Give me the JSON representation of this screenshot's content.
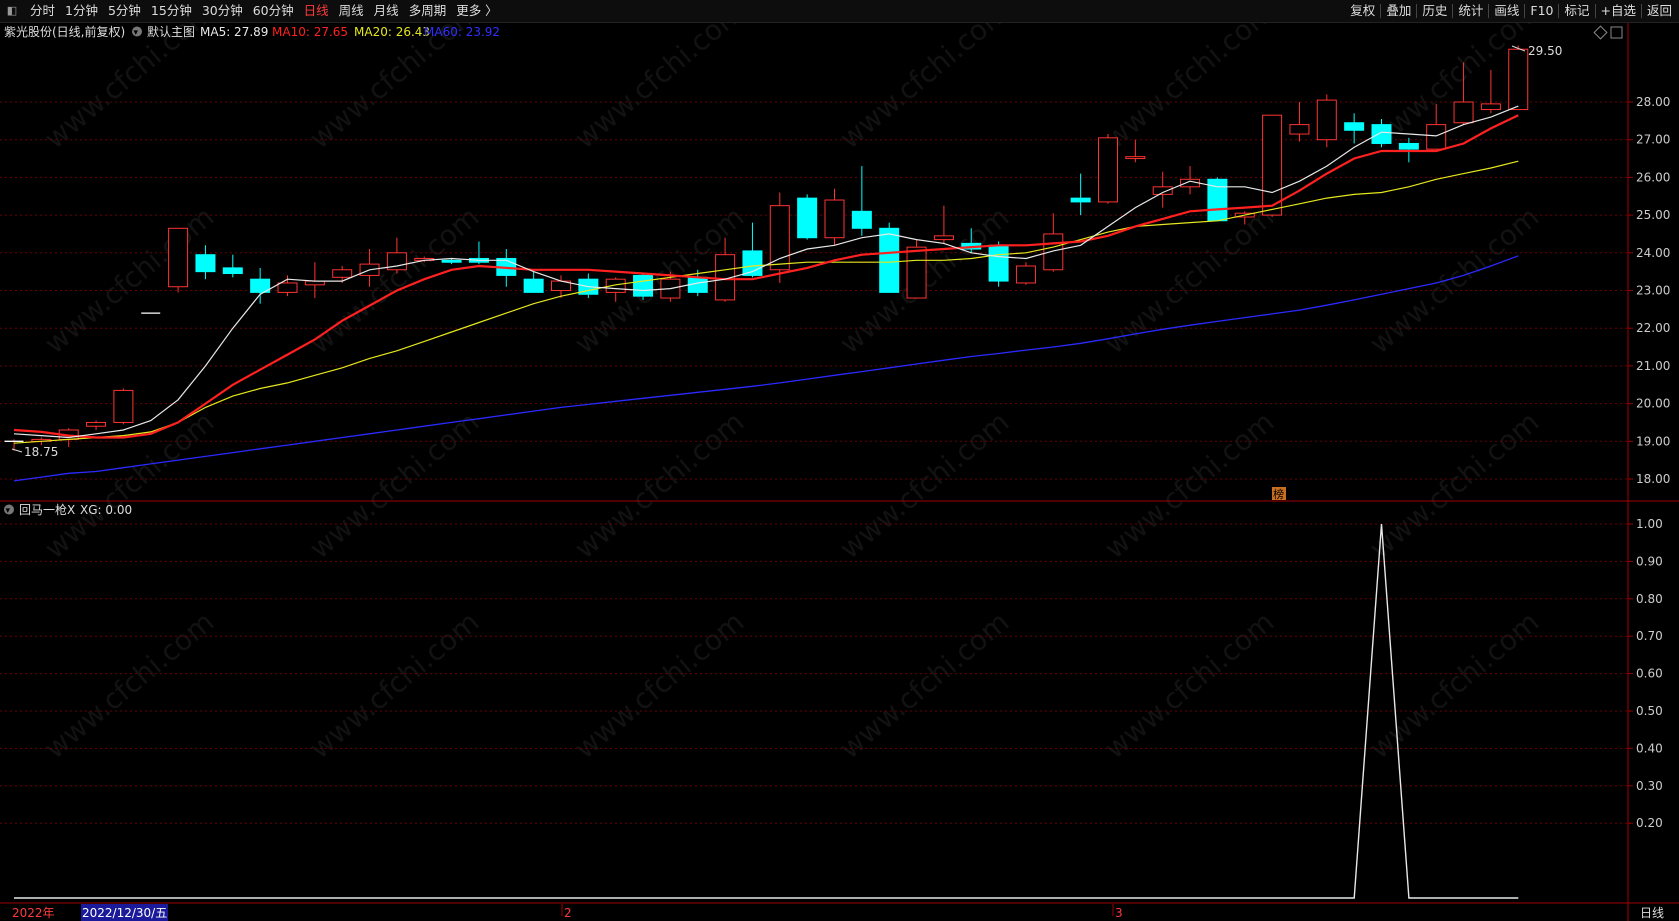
{
  "toolbar": {
    "tabs": [
      "分时",
      "1分钟",
      "5分钟",
      "15分钟",
      "30分钟",
      "60分钟",
      "日线",
      "周线",
      "月线",
      "多周期",
      "更多 〉"
    ],
    "active_tab": "日线",
    "tools": [
      "复权",
      "叠加",
      "历史",
      "统计",
      "画线",
      "F10",
      "标记",
      "+自选",
      "返回"
    ]
  },
  "main_legend": {
    "stock": "紫光股份(日线,前复权)",
    "template": "默认主图",
    "ma5": "MA5: 27.89",
    "ma10": "MA10: 27.65",
    "ma20": "MA20: 26.43",
    "ma60": "MA60: 23.92"
  },
  "colors": {
    "up": "#ff3232",
    "down": "#00ffff",
    "ma5": "#e8e8e8",
    "ma10": "#ff2020",
    "ma20": "#e6e61e",
    "ma60": "#2a2aff",
    "axis": "#a00000",
    "grid": "#6a0000"
  },
  "sub_legend": {
    "name": "回马一枪X",
    "value": "XG: 0.00"
  },
  "bottom_bar": {
    "year_label": "2022年",
    "cursor_date": "2022/12/30/五",
    "month_feb": "2",
    "month_mar": "3",
    "period": "日线"
  },
  "annotations": {
    "max_price": "29.50",
    "min_price": "18.75",
    "marker": "榜"
  },
  "watermark": "www.cfchi.com",
  "chart_data": [
    {
      "type": "candlestick",
      "title": "紫光股份(日线,前复权)",
      "ylim": [
        17.6,
        30.0
      ],
      "yticks": [
        "18.00",
        "19.00",
        "20.00",
        "21.00",
        "22.00",
        "23.00",
        "24.00",
        "25.00",
        "26.00",
        "27.00",
        "28.00"
      ],
      "candles": [
        {
          "o": 19.0,
          "h": 19.05,
          "l": 18.75,
          "c": 19.0
        },
        {
          "o": 19.0,
          "h": 19.1,
          "l": 18.9,
          "c": 19.05
        },
        {
          "o": 19.05,
          "h": 19.35,
          "l": 18.85,
          "c": 19.3
        },
        {
          "o": 19.4,
          "h": 19.55,
          "l": 19.3,
          "c": 19.5
        },
        {
          "o": 19.5,
          "h": 20.4,
          "l": 19.45,
          "c": 20.35
        },
        {
          "o": 22.4,
          "h": 22.4,
          "l": 22.4,
          "c": 22.4
        },
        {
          "o": 23.1,
          "h": 24.65,
          "l": 22.95,
          "c": 24.65
        },
        {
          "o": 23.95,
          "h": 24.2,
          "l": 23.3,
          "c": 23.5
        },
        {
          "o": 23.6,
          "h": 23.95,
          "l": 23.35,
          "c": 23.45
        },
        {
          "o": 23.3,
          "h": 23.6,
          "l": 22.65,
          "c": 22.95
        },
        {
          "o": 22.95,
          "h": 23.4,
          "l": 22.85,
          "c": 23.2
        },
        {
          "o": 23.15,
          "h": 23.75,
          "l": 22.8,
          "c": 23.25
        },
        {
          "o": 23.35,
          "h": 23.65,
          "l": 23.2,
          "c": 23.55
        },
        {
          "o": 23.4,
          "h": 24.1,
          "l": 23.1,
          "c": 23.7
        },
        {
          "o": 23.55,
          "h": 24.4,
          "l": 23.45,
          "c": 24.0
        },
        {
          "o": 23.8,
          "h": 23.9,
          "l": 23.75,
          "c": 23.85
        },
        {
          "o": 23.8,
          "h": 23.85,
          "l": 23.7,
          "c": 23.75
        },
        {
          "o": 23.85,
          "h": 24.3,
          "l": 23.7,
          "c": 23.75
        },
        {
          "o": 23.85,
          "h": 24.1,
          "l": 23.1,
          "c": 23.4
        },
        {
          "o": 23.3,
          "h": 23.5,
          "l": 22.95,
          "c": 22.95
        },
        {
          "o": 23.0,
          "h": 23.4,
          "l": 22.8,
          "c": 23.25
        },
        {
          "o": 23.3,
          "h": 23.45,
          "l": 22.8,
          "c": 22.9
        },
        {
          "o": 22.95,
          "h": 23.35,
          "l": 22.7,
          "c": 23.3
        },
        {
          "o": 23.4,
          "h": 23.45,
          "l": 22.75,
          "c": 22.85
        },
        {
          "o": 22.8,
          "h": 23.5,
          "l": 22.7,
          "c": 23.3
        },
        {
          "o": 23.35,
          "h": 23.55,
          "l": 22.85,
          "c": 22.95
        },
        {
          "o": 22.75,
          "h": 24.4,
          "l": 22.7,
          "c": 23.95
        },
        {
          "o": 24.05,
          "h": 24.8,
          "l": 23.35,
          "c": 23.4
        },
        {
          "o": 23.55,
          "h": 25.6,
          "l": 23.2,
          "c": 25.25
        },
        {
          "o": 25.45,
          "h": 25.55,
          "l": 24.35,
          "c": 24.4
        },
        {
          "o": 24.4,
          "h": 25.7,
          "l": 24.2,
          "c": 25.4
        },
        {
          "o": 25.1,
          "h": 26.3,
          "l": 24.45,
          "c": 24.65
        },
        {
          "o": 24.65,
          "h": 24.8,
          "l": 22.95,
          "c": 22.95
        },
        {
          "o": 22.8,
          "h": 24.35,
          "l": 22.8,
          "c": 24.15
        },
        {
          "o": 24.35,
          "h": 25.25,
          "l": 24.25,
          "c": 24.45
        },
        {
          "o": 24.25,
          "h": 24.65,
          "l": 24.0,
          "c": 24.1
        },
        {
          "o": 24.2,
          "h": 24.3,
          "l": 23.1,
          "c": 23.25
        },
        {
          "o": 23.2,
          "h": 23.75,
          "l": 23.15,
          "c": 23.65
        },
        {
          "o": 23.55,
          "h": 25.05,
          "l": 23.5,
          "c": 24.5
        },
        {
          "o": 25.45,
          "h": 26.1,
          "l": 25.0,
          "c": 25.35
        },
        {
          "o": 25.35,
          "h": 27.15,
          "l": 25.3,
          "c": 27.05
        },
        {
          "o": 26.5,
          "h": 27.0,
          "l": 26.4,
          "c": 26.55
        },
        {
          "o": 25.55,
          "h": 26.15,
          "l": 25.2,
          "c": 25.75
        },
        {
          "o": 25.75,
          "h": 26.3,
          "l": 25.55,
          "c": 25.95
        },
        {
          "o": 25.95,
          "h": 26.0,
          "l": 24.85,
          "c": 24.85
        },
        {
          "o": 24.95,
          "h": 25.1,
          "l": 24.75,
          "c": 25.05
        },
        {
          "o": 25.0,
          "h": 27.65,
          "l": 24.95,
          "c": 27.65
        },
        {
          "o": 27.15,
          "h": 28.0,
          "l": 26.95,
          "c": 27.4
        },
        {
          "o": 27.0,
          "h": 28.2,
          "l": 26.8,
          "c": 28.05
        },
        {
          "o": 27.45,
          "h": 27.7,
          "l": 26.9,
          "c": 27.25
        },
        {
          "o": 27.4,
          "h": 27.55,
          "l": 26.8,
          "c": 26.9
        },
        {
          "o": 26.9,
          "h": 27.05,
          "l": 26.4,
          "c": 26.75
        },
        {
          "o": 26.75,
          "h": 27.95,
          "l": 26.75,
          "c": 27.4
        },
        {
          "o": 27.45,
          "h": 29.05,
          "l": 27.4,
          "c": 28.0
        },
        {
          "o": 27.8,
          "h": 28.85,
          "l": 27.7,
          "c": 27.95
        },
        {
          "o": 27.8,
          "h": 29.5,
          "l": 27.8,
          "c": 29.4
        }
      ],
      "ma5": [
        19.2,
        19.15,
        19.1,
        19.2,
        19.3,
        19.55,
        20.1,
        21.0,
        22.0,
        22.9,
        23.3,
        23.25,
        23.25,
        23.55,
        23.65,
        23.8,
        23.85,
        23.8,
        23.8,
        23.5,
        23.25,
        23.1,
        23.05,
        23.0,
        23.05,
        23.2,
        23.3,
        23.5,
        23.85,
        24.1,
        24.2,
        24.4,
        24.5,
        24.35,
        24.25,
        24.0,
        23.9,
        23.85,
        24.05,
        24.2,
        24.7,
        25.2,
        25.6,
        25.9,
        25.75,
        25.75,
        25.6,
        25.9,
        26.3,
        26.8,
        27.2,
        27.15,
        27.1,
        27.4,
        27.6,
        27.89
      ],
      "ma10": [
        19.3,
        19.25,
        19.15,
        19.1,
        19.1,
        19.2,
        19.5,
        20.0,
        20.5,
        20.9,
        21.3,
        21.7,
        22.2,
        22.6,
        23.0,
        23.3,
        23.55,
        23.65,
        23.6,
        23.55,
        23.55,
        23.55,
        23.5,
        23.45,
        23.4,
        23.35,
        23.3,
        23.3,
        23.45,
        23.6,
        23.8,
        23.95,
        24.0,
        24.05,
        24.1,
        24.15,
        24.2,
        24.2,
        24.25,
        24.3,
        24.45,
        24.7,
        24.9,
        25.1,
        25.15,
        25.2,
        25.25,
        25.65,
        26.1,
        26.5,
        26.7,
        26.7,
        26.7,
        26.9,
        27.3,
        27.65
      ],
      "ma20": [
        18.95,
        19.0,
        19.05,
        19.1,
        19.15,
        19.25,
        19.5,
        19.9,
        20.2,
        20.4,
        20.55,
        20.75,
        20.95,
        21.2,
        21.4,
        21.65,
        21.9,
        22.15,
        22.4,
        22.65,
        22.85,
        23.0,
        23.15,
        23.25,
        23.35,
        23.45,
        23.55,
        23.65,
        23.7,
        23.75,
        23.75,
        23.75,
        23.75,
        23.8,
        23.8,
        23.85,
        23.95,
        24.0,
        24.15,
        24.35,
        24.55,
        24.7,
        24.75,
        24.8,
        24.85,
        25.0,
        25.15,
        25.3,
        25.45,
        25.55,
        25.6,
        25.75,
        25.95,
        26.1,
        26.25,
        26.43
      ],
      "ma60": [
        17.95,
        18.05,
        18.15,
        18.2,
        18.3,
        18.4,
        18.5,
        18.6,
        18.7,
        18.8,
        18.9,
        19.0,
        19.1,
        19.2,
        19.3,
        19.4,
        19.5,
        19.6,
        19.7,
        19.8,
        19.9,
        19.98,
        20.06,
        20.14,
        20.22,
        20.3,
        20.38,
        20.46,
        20.55,
        20.65,
        20.75,
        20.85,
        20.95,
        21.05,
        21.15,
        21.25,
        21.33,
        21.42,
        21.5,
        21.6,
        21.72,
        21.85,
        21.97,
        22.08,
        22.18,
        22.28,
        22.38,
        22.48,
        22.61,
        22.75,
        22.9,
        23.05,
        23.2,
        23.4,
        23.65,
        23.92
      ]
    },
    {
      "type": "line",
      "title": "回马一枪X",
      "series": [
        {
          "name": "XG",
          "values": [
            0,
            0,
            0,
            0,
            0,
            0,
            0,
            0,
            0,
            0,
            0,
            0,
            0,
            0,
            0,
            0,
            0,
            0,
            0,
            0,
            0,
            0,
            0,
            0,
            0,
            0,
            0,
            0,
            0,
            0,
            0,
            0,
            0,
            0,
            0,
            0,
            0,
            0,
            0,
            0,
            0,
            0,
            0,
            0,
            0,
            0,
            0,
            0,
            0,
            0,
            1,
            0,
            0,
            0,
            0,
            0
          ]
        }
      ],
      "ylim": [
        0,
        1.0
      ],
      "yticks": [
        "1.00",
        "0.90",
        "0.80",
        "0.70",
        "0.60",
        "0.50",
        "0.40",
        "0.30",
        "0.20"
      ]
    }
  ]
}
